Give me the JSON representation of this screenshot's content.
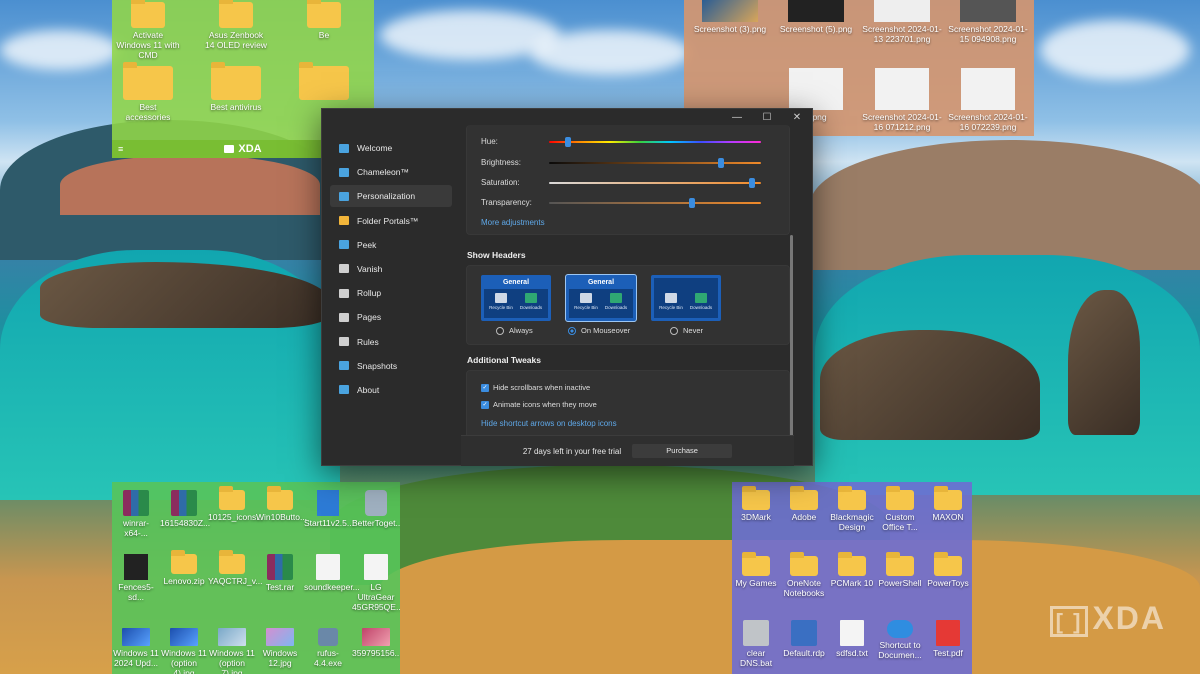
{
  "desktop": {
    "fence_top_left": {
      "bar_label": "XDA",
      "icons": [
        {
          "label": "Activate Windows 11 with CMD",
          "icon": "folder-icon"
        },
        {
          "label": "Asus Zenbook 14 OLED review",
          "icon": "folder-icon"
        },
        {
          "label": "Be",
          "icon": "folder-icon"
        },
        {
          "label": "Best accessories",
          "icon": "folder-icon"
        },
        {
          "label": "Best antivirus",
          "icon": "folder-icon"
        }
      ]
    },
    "fence_top_right": {
      "icons": [
        {
          "label": "Screenshot (3).png"
        },
        {
          "label": "Screenshot (5).png"
        },
        {
          "label": "Screenshot 2024-01-13 223701.png"
        },
        {
          "label": "Screenshot 2024-01-15 094908.png"
        },
        {
          "label": "2.png"
        },
        {
          "label": "Screenshot 2024-01-16 071212.png"
        },
        {
          "label": "Screenshot 2024-01-16 072239.png"
        }
      ]
    },
    "fence_bottom_left": {
      "icons": [
        {
          "label": "winrar-x64-...",
          "icon": "winrar-icon"
        },
        {
          "label": "16154830Z...",
          "icon": "winrar-icon"
        },
        {
          "label": "10125_icons...",
          "icon": "folder-icon"
        },
        {
          "label": "Win10Butto...",
          "icon": "folder-icon"
        },
        {
          "label": "Start11v2.5...",
          "icon": "installer-icon"
        },
        {
          "label": "BetterToget...",
          "icon": "app-icon"
        },
        {
          "label": "Fences5-sd...",
          "icon": "app-icon"
        },
        {
          "label": "Lenovo.zip",
          "icon": "folder-icon"
        },
        {
          "label": "YAQCTRJ_v...",
          "icon": "folder-icon"
        },
        {
          "label": "Test.rar",
          "icon": "winrar-icon"
        },
        {
          "label": "soundkeeper...",
          "icon": "document-icon"
        },
        {
          "label": "LG UltraGear 45GR95QE...",
          "icon": "document-icon"
        },
        {
          "label": "Windows 11 2024 Upd...",
          "icon": "image-icon"
        },
        {
          "label": "Windows 11 (option 4).jpg",
          "icon": "image-icon"
        },
        {
          "label": "Windows 11 (option 7).jpg",
          "icon": "image-icon"
        },
        {
          "label": "Windows 12.jpg",
          "icon": "image-icon"
        },
        {
          "label": "rufus-4.4.exe",
          "icon": "app-icon"
        },
        {
          "label": "359795156...",
          "icon": "image-icon"
        }
      ]
    },
    "fence_bottom_right": {
      "icons": [
        {
          "label": "3DMark",
          "icon": "folder-icon"
        },
        {
          "label": "Adobe",
          "icon": "folder-icon"
        },
        {
          "label": "Blackmagic Design",
          "icon": "folder-icon"
        },
        {
          "label": "Custom Office T...",
          "icon": "folder-icon"
        },
        {
          "label": "MAXON",
          "icon": "folder-icon"
        },
        {
          "label": "My Games",
          "icon": "folder-icon"
        },
        {
          "label": "OneNote Notebooks",
          "icon": "folder-icon"
        },
        {
          "label": "PCMark 10",
          "icon": "folder-icon"
        },
        {
          "label": "PowerShell",
          "icon": "folder-icon"
        },
        {
          "label": "PowerToys",
          "icon": "folder-icon"
        },
        {
          "label": "clear DNS.bat",
          "icon": "gear-icon"
        },
        {
          "label": "Default.rdp",
          "icon": "monitor-icon"
        },
        {
          "label": "sdfsd.txt",
          "icon": "document-icon"
        },
        {
          "label": "Shortcut to Documen...",
          "icon": "cloud-icon"
        },
        {
          "label": "Test.pdf",
          "icon": "pdf-icon"
        }
      ]
    },
    "watermark": "XDA"
  },
  "app": {
    "window_controls": {
      "minimize": "—",
      "maximize": "☐",
      "close": "✕"
    },
    "nav": [
      {
        "label": "Welcome",
        "active": false,
        "color": "#4aa3df"
      },
      {
        "label": "Chameleon™",
        "active": false,
        "color": "#4aa3df"
      },
      {
        "label": "Personalization",
        "active": true,
        "color": "#4aa3df"
      },
      {
        "label": "Folder Portals™",
        "active": false,
        "color": "#f2b53a"
      },
      {
        "label": "Peek",
        "active": false,
        "color": "#4aa3df"
      },
      {
        "label": "Vanish",
        "active": false,
        "color": "#cfcfcf"
      },
      {
        "label": "Rollup",
        "active": false,
        "color": "#cfcfcf"
      },
      {
        "label": "Pages",
        "active": false,
        "color": "#cfcfcf"
      },
      {
        "label": "Rules",
        "active": false,
        "color": "#cfcfcf"
      },
      {
        "label": "Snapshots",
        "active": false,
        "color": "#4aa3df"
      },
      {
        "label": "About",
        "active": false,
        "color": "#4aa3df"
      }
    ],
    "sliders": [
      {
        "label": "Hue:",
        "value": 0.08
      },
      {
        "label": "Brightness:",
        "value": 0.82
      },
      {
        "label": "Saturation:",
        "value": 0.97
      },
      {
        "label": "Transparency:",
        "value": 0.68
      }
    ],
    "more_adjustments": "More adjustments",
    "show_headers": {
      "title": "Show Headers",
      "preview_title": "General",
      "preview_items": [
        "Recycle Bin",
        "Downloads"
      ],
      "options": [
        {
          "label": "Always",
          "selected": false
        },
        {
          "label": "On Mouseover",
          "selected": true
        },
        {
          "label": "Never",
          "selected": false
        }
      ]
    },
    "additional_tweaks": {
      "title": "Additional Tweaks",
      "checks": [
        {
          "label": "Hide scrollbars when inactive",
          "checked": true
        },
        {
          "label": "Animate icons when they move",
          "checked": true
        }
      ],
      "link": "Hide shortcut arrows on desktop icons"
    },
    "footer": {
      "trial_text": "27 days left in your free trial",
      "purchase_label": "Purchase"
    },
    "accent": "#3b8de0"
  }
}
